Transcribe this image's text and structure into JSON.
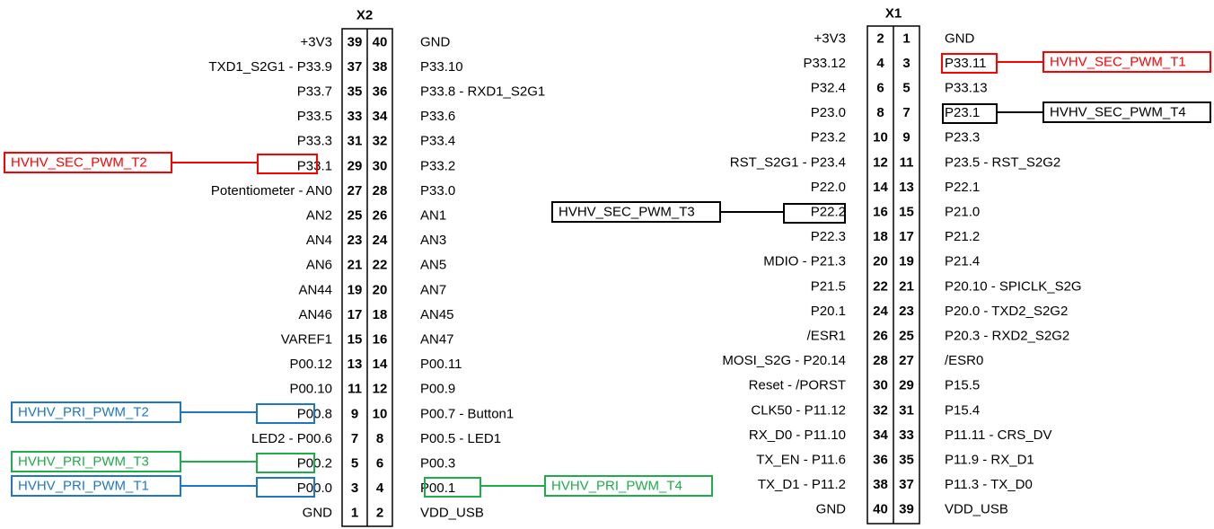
{
  "colors": {
    "red": "#ff0000",
    "black": "#000000",
    "blue": "#1f77c4",
    "green": "#1fac4a"
  },
  "x2": {
    "title": "X2",
    "rows": [
      {
        "left_pin": "39",
        "right_pin": "40",
        "left_label": "+3V3",
        "right_label": "GND"
      },
      {
        "left_pin": "37",
        "right_pin": "38",
        "left_label": "TXD1_S2G1 - P33.9",
        "right_label": "P33.10"
      },
      {
        "left_pin": "35",
        "right_pin": "36",
        "left_label": "P33.7",
        "right_label": "P33.8 - RXD1_S2G1"
      },
      {
        "left_pin": "33",
        "right_pin": "34",
        "left_label": "P33.5",
        "right_label": "P33.6"
      },
      {
        "left_pin": "31",
        "right_pin": "32",
        "left_label": "P33.3",
        "right_label": "P33.4"
      },
      {
        "left_pin": "29",
        "right_pin": "30",
        "left_label": "P33.1",
        "right_label": "P33.2"
      },
      {
        "left_pin": "27",
        "right_pin": "28",
        "left_label": "Potentiometer - AN0",
        "right_label": "P33.0"
      },
      {
        "left_pin": "25",
        "right_pin": "26",
        "left_label": "AN2",
        "right_label": "AN1"
      },
      {
        "left_pin": "23",
        "right_pin": "24",
        "left_label": "AN4",
        "right_label": "AN3"
      },
      {
        "left_pin": "21",
        "right_pin": "22",
        "left_label": "AN6",
        "right_label": "AN5"
      },
      {
        "left_pin": "19",
        "right_pin": "20",
        "left_label": "AN44",
        "right_label": "AN7"
      },
      {
        "left_pin": "17",
        "right_pin": "18",
        "left_label": "AN46",
        "right_label": "AN45"
      },
      {
        "left_pin": "15",
        "right_pin": "16",
        "left_label": "VAREF1",
        "right_label": "AN47"
      },
      {
        "left_pin": "13",
        "right_pin": "14",
        "left_label": "P00.12",
        "right_label": "P00.11"
      },
      {
        "left_pin": "11",
        "right_pin": "12",
        "left_label": "P00.10",
        "right_label": "P00.9"
      },
      {
        "left_pin": "9",
        "right_pin": "10",
        "left_label": "P00.8",
        "right_label": "P00.7 - Button1"
      },
      {
        "left_pin": "7",
        "right_pin": "8",
        "left_label": "LED2 - P00.6",
        "right_label": "P00.5 - LED1"
      },
      {
        "left_pin": "5",
        "right_pin": "6",
        "left_label": "P00.2",
        "right_label": "P00.3"
      },
      {
        "left_pin": "3",
        "right_pin": "4",
        "left_label": "P00.0",
        "right_label": "P00.1"
      },
      {
        "left_pin": "1",
        "right_pin": "2",
        "left_label": "GND",
        "right_label": "VDD_USB"
      }
    ]
  },
  "x1": {
    "title": "X1",
    "rows": [
      {
        "left_pin": "2",
        "right_pin": "1",
        "left_label": "+3V3",
        "right_label": "GND"
      },
      {
        "left_pin": "4",
        "right_pin": "3",
        "left_label": "P33.12",
        "right_label": "P33.11"
      },
      {
        "left_pin": "6",
        "right_pin": "5",
        "left_label": "P32.4",
        "right_label": "P33.13"
      },
      {
        "left_pin": "8",
        "right_pin": "7",
        "left_label": "P23.0",
        "right_label": "P23.1"
      },
      {
        "left_pin": "10",
        "right_pin": "9",
        "left_label": "P23.2",
        "right_label": "P23.3"
      },
      {
        "left_pin": "12",
        "right_pin": "11",
        "left_label": "RST_S2G1 - P23.4",
        "right_label": "P23.5 - RST_S2G2"
      },
      {
        "left_pin": "14",
        "right_pin": "13",
        "left_label": "P22.0",
        "right_label": "P22.1"
      },
      {
        "left_pin": "16",
        "right_pin": "15",
        "left_label": "P22.2",
        "right_label": "P21.0"
      },
      {
        "left_pin": "18",
        "right_pin": "17",
        "left_label": "P22.3",
        "right_label": "P21.2"
      },
      {
        "left_pin": "20",
        "right_pin": "19",
        "left_label": "MDIO - P21.3",
        "right_label": "P21.4"
      },
      {
        "left_pin": "22",
        "right_pin": "21",
        "left_label": "P21.5",
        "right_label": "P20.10 - SPICLK_S2G"
      },
      {
        "left_pin": "24",
        "right_pin": "23",
        "left_label": "P20.1",
        "right_label": "P20.0 - TXD2_S2G2"
      },
      {
        "left_pin": "26",
        "right_pin": "25",
        "left_label": "/ESR1",
        "right_label": "P20.3 - RXD2_S2G2"
      },
      {
        "left_pin": "28",
        "right_pin": "27",
        "left_label": "MOSI_S2G - P20.14",
        "right_label": "/ESR0"
      },
      {
        "left_pin": "30",
        "right_pin": "29",
        "left_label": "Reset - /PORST",
        "right_label": "P15.5"
      },
      {
        "left_pin": "32",
        "right_pin": "31",
        "left_label": "CLK50 - P11.12",
        "right_label": "P15.4"
      },
      {
        "left_pin": "34",
        "right_pin": "33",
        "left_label": "RX_D0 - P11.10",
        "right_label": "P11.11 - CRS_DV"
      },
      {
        "left_pin": "36",
        "right_pin": "35",
        "left_label": "TX_EN - P11.6",
        "right_label": "P11.9 - RX_D1"
      },
      {
        "left_pin": "38",
        "right_pin": "37",
        "left_label": "TX_D1 - P11.2",
        "right_label": "P11.3 - TX_D0"
      },
      {
        "left_pin": "40",
        "right_pin": "39",
        "left_label": "GND",
        "right_label": "VDD_USB"
      }
    ]
  },
  "signals": {
    "sec_t1": "HVHV_SEC_PWM_T1",
    "sec_t2": "HVHV_SEC_PWM_T2",
    "sec_t3": "HVHV_SEC_PWM_T3",
    "sec_t4": "HVHV_SEC_PWM_T4",
    "pri_t1": "HVHV_PRI_PWM_T1",
    "pri_t2": "HVHV_PRI_PWM_T2",
    "pri_t3": "HVHV_PRI_PWM_T3",
    "pri_t4": "HVHV_PRI_PWM_T4"
  }
}
